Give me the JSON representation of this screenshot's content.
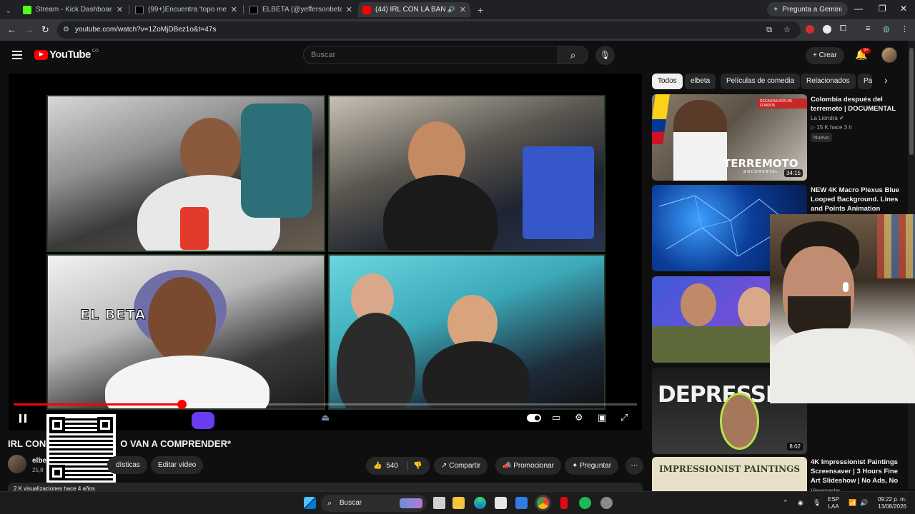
{
  "browser": {
    "tabs": [
      {
        "title": "Stream - Kick Dashboard",
        "color": "#53fc18"
      },
      {
        "title": "(99+)Encuentra 'topo mexicano'",
        "color": "#ffffff"
      },
      {
        "title": "ELBETA (@yeffersonbeta) | TikTok",
        "color": "#ffffff"
      },
      {
        "title": "(44) IRL CON LA BANDA*N",
        "color": "#ff0000"
      }
    ],
    "gemini_label": "Pregunta a Gemini",
    "url": "youtube.com/watch?v=1ZoMjDBez1o&t=47s"
  },
  "youtube": {
    "logo_text": "YouTube",
    "country_code": "CO",
    "search_placeholder": "Buscar",
    "create_label": "Crear",
    "notification_count": "9+"
  },
  "player": {
    "overlay_label": "EL BETA",
    "progress_fraction": 0.27
  },
  "video": {
    "title_start": "IRL CON",
    "title_end": "O VAN A COMPRENDER*",
    "channel_name": "elbe",
    "channel_subs": "25,8",
    "stats_label": "dísticas",
    "edit_label": "Editar vídeo",
    "likes": "540",
    "share_label": "Compartir",
    "promote_label": "Promocionar",
    "ask_label": "Preguntar",
    "views_line": "2 K visualizaciones  hace 4 años"
  },
  "chips": [
    "Todos",
    "elbeta",
    "Películas de comedia",
    "Relacionados",
    "Par"
  ],
  "recommendations": [
    {
      "title": "Colombia después del terremoto | DOCUMENTAL",
      "channel": "La Liendra",
      "meta": "15 K   hace 3 h",
      "badge": "Nuevo",
      "duration": "34:15",
      "thumb_text": "TERREMOTO",
      "thumb_sub": "DOCUMENTAL",
      "thumb_banner": "RECAUDACIÓN DE FONDOS"
    },
    {
      "title": "NEW 4K Macro Plexus Blue Looped Background. Lines and Points Animation 60FP...",
      "channel": "",
      "meta": "",
      "badge": "",
      "duration": ""
    },
    {
      "title": "",
      "channel": "",
      "meta": "",
      "badge": "",
      "duration": ""
    },
    {
      "title": "",
      "channel": "",
      "meta": "",
      "badge": "",
      "duration": "8:02",
      "thumb_text": "DEPRESSION"
    },
    {
      "title": "4K Impressionist Paintings Screensaver | 3 Hours Fine Art Slideshow | No Ads, No ...",
      "channel": "Viewmaster",
      "meta": "",
      "badge": "",
      "duration": "",
      "thumb_text": "IMPRESSIONIST PAINTINGS"
    }
  ],
  "taskbar": {
    "search_label": "Buscar",
    "lang_top": "ESP",
    "lang_bottom": "LAA",
    "time": "09:22 p. m.",
    "date": "13/08/2026"
  }
}
